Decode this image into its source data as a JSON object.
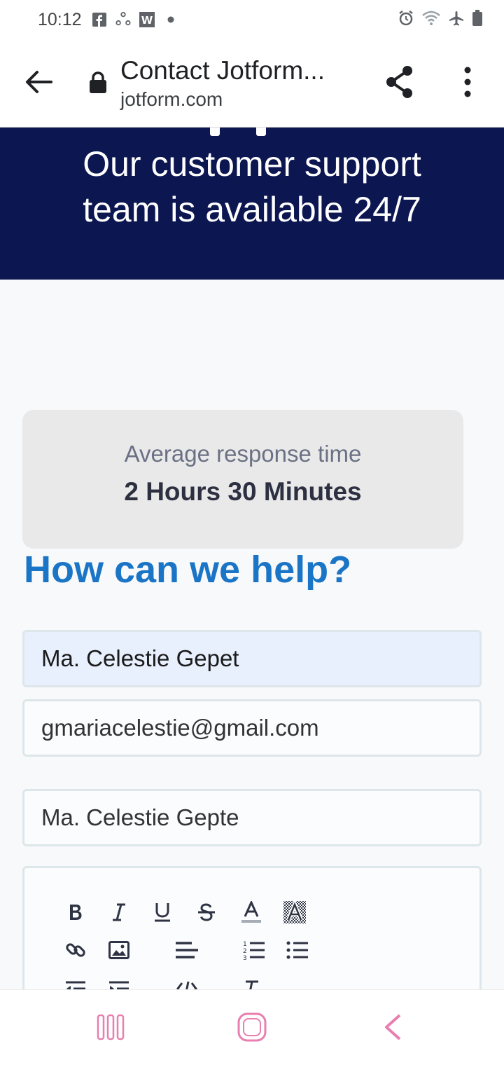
{
  "status_bar": {
    "time": "10:12",
    "left_icons": [
      "facebook-icon",
      "sync-icon",
      "w-app-icon",
      "dot-icon"
    ],
    "right_icons": [
      "alarm-icon",
      "wifi-icon",
      "airplane-icon",
      "battery-icon"
    ]
  },
  "browser": {
    "title": "Contact Jotform...",
    "host": "jotform.com"
  },
  "hero": {
    "line1": "Our customer support",
    "line2": "team is available 24/7",
    "bg_color": "#0c1650"
  },
  "response": {
    "label": "Average response time",
    "value": "2 Hours 30 Minutes"
  },
  "help_heading": "How can we help?",
  "form": {
    "name_value": "Ma. Celestie Gepet",
    "email_value": "gmariacelestie@gmail.com",
    "subject_value": "Ma. Celestie Gepte"
  },
  "editor_toolbar": [
    "bold-icon",
    "italic-icon",
    "underline-icon",
    "strikethrough-icon",
    "font-color-icon",
    "background-color-icon",
    "link-icon",
    "image-icon",
    "align-icon",
    "ordered-list-icon",
    "unordered-list-icon",
    "outdent-icon",
    "indent-icon",
    "code-icon",
    "clear-format-icon"
  ],
  "colors": {
    "accent": "#1b75c6",
    "hero": "#0c1650",
    "nav_icons": "#e87fb0"
  }
}
